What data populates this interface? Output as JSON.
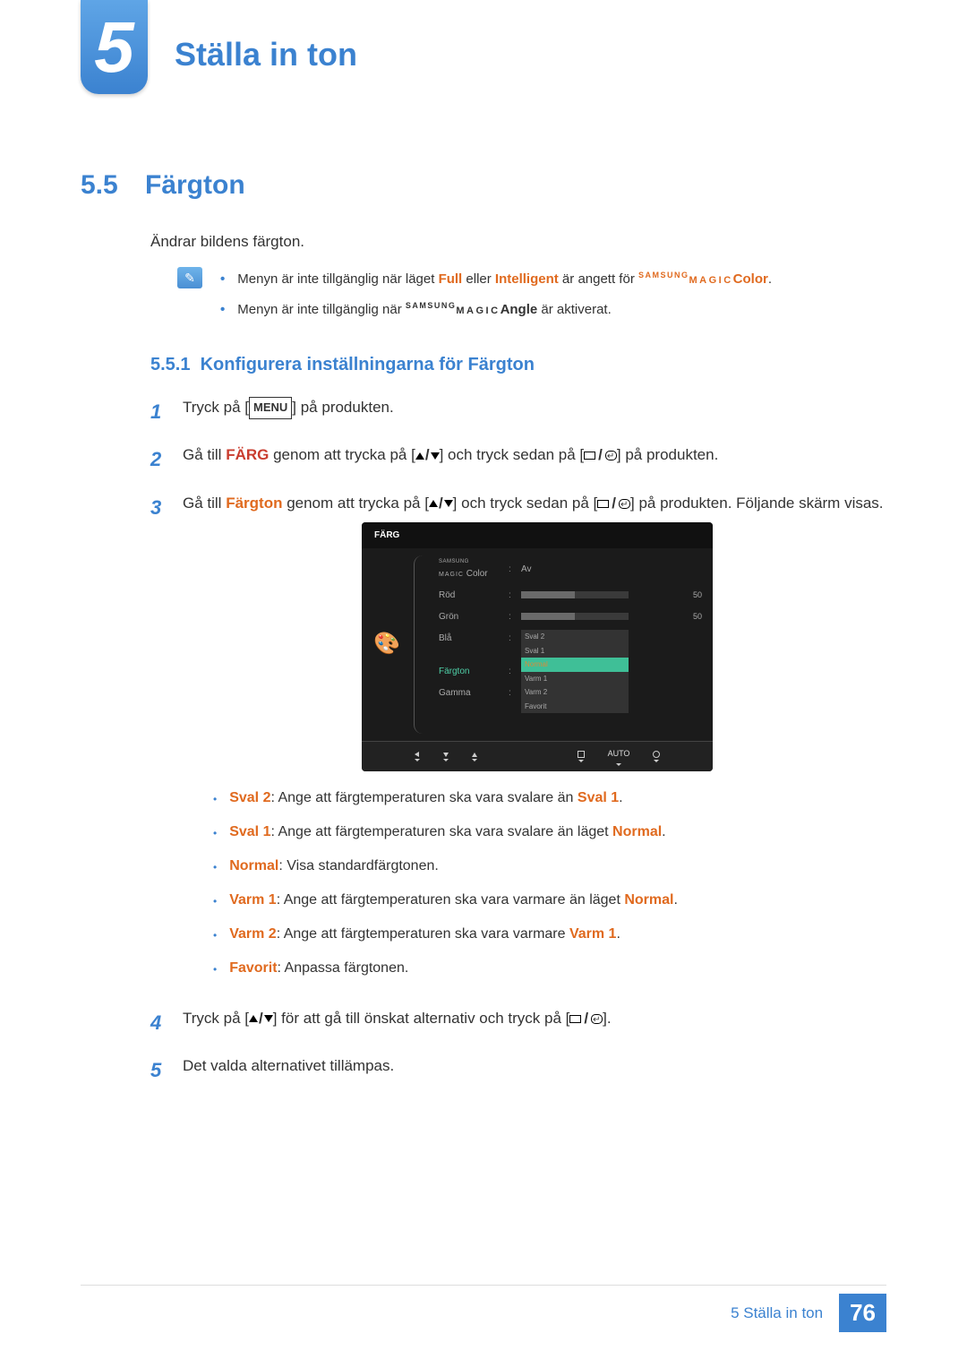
{
  "chapter": {
    "number": "5",
    "title": "Ställa in ton"
  },
  "section": {
    "number": "5.5",
    "title": "Färgton"
  },
  "intro": "Ändrar bildens färgton.",
  "notes": {
    "n1_pre": "Menyn är inte tillgänglig när läget ",
    "n1_full": "Full",
    "n1_or": " eller ",
    "n1_intelligent": "Intelligent",
    "n1_post1": " är angett för ",
    "n1_brand": "SAMSUNG",
    "n1_magic": "MAGIC",
    "n1_color": "Color",
    "n1_end": ".",
    "n2_pre": "Menyn är inte tillgänglig när ",
    "n2_brand": "SAMSUNG",
    "n2_magic": "MAGIC",
    "n2_angle": "Angle",
    "n2_post": " är aktiverat."
  },
  "subsection": {
    "number": "5.5.1",
    "title": "Konfigurera inställningarna för Färgton"
  },
  "steps": {
    "s1_a": "Tryck på [",
    "s1_menu": "MENU",
    "s1_b": "] på produkten.",
    "s2_a": "Gå till ",
    "s2_farg": "FÄRG",
    "s2_b": " genom att trycka på [",
    "s2_c": "] och tryck sedan på [",
    "s2_d": "] på produkten.",
    "s3_a": "Gå till ",
    "s3_fargton": "Färgton",
    "s3_b": " genom att trycka på [",
    "s3_c": "] och tryck sedan på [",
    "s3_d": "] på produkten. Följande skärm visas.",
    "s4_a": "Tryck på [",
    "s4_b": "] för att gå till önskat alternativ och tryck på [",
    "s4_c": "].",
    "s5": "Det valda alternativet tillämpas."
  },
  "osd": {
    "title": "FÄRG",
    "rows": {
      "magic_brand": "SAMSUNG",
      "magic": "MAGIC",
      "magic_suffix": " Color",
      "magic_val": "Av",
      "red": "Röd",
      "red_val": "50",
      "green": "Grön",
      "green_val": "50",
      "blue": "Blå",
      "tone": "Färgton",
      "gamma": "Gamma"
    },
    "dropdown": [
      "Sval 2",
      "Sval 1",
      "Normal",
      "Varm 1",
      "Varm 2",
      "Favorit"
    ],
    "footer_auto": "AUTO"
  },
  "options": {
    "sval2_name": "Sval 2",
    "sval2_text": ": Ange att färgtemperaturen ska vara svalare än ",
    "sval2_ref": "Sval 1",
    "sval1_name": "Sval 1",
    "sval1_text": ": Ange att färgtemperaturen ska vara svalare än läget ",
    "sval1_ref": "Normal",
    "normal_name": "Normal",
    "normal_text": ": Visa standardfärgtonen.",
    "varm1_name": "Varm 1",
    "varm1_text": ": Ange att färgtemperaturen ska vara varmare än läget ",
    "varm1_ref": "Normal",
    "varm2_name": "Varm 2",
    "varm2_text": ": Ange att färgtemperaturen ska vara varmare ",
    "varm2_ref": "Varm 1",
    "favorit_name": "Favorit",
    "favorit_text": ": Anpassa färgtonen."
  },
  "footer": {
    "text": "5 Ställa in ton",
    "page": "76"
  }
}
